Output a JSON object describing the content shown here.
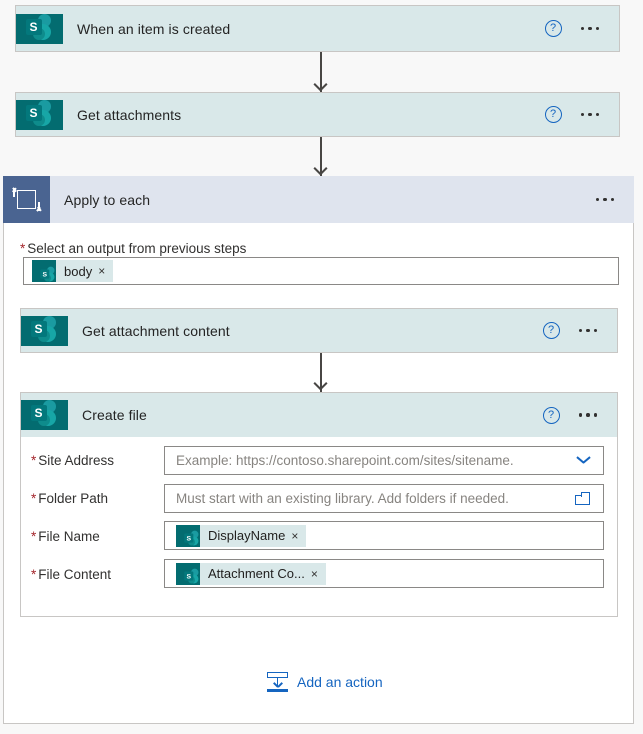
{
  "flow": {
    "steps": [
      {
        "id": "when-an-item-is-created",
        "title": "When an item is created",
        "icon": "sharepoint-icon",
        "help_glyph": "?",
        "menu_glyph": "…"
      },
      {
        "id": "get-attachments",
        "title": "Get attachments",
        "icon": "sharepoint-icon",
        "help_glyph": "?",
        "menu_glyph": "…"
      }
    ],
    "loop": {
      "title": "Apply to each",
      "icon": "loop-icon",
      "menu_glyph": "…",
      "output_field": {
        "required_marker": "*",
        "label": "Select an output from previous steps",
        "token": {
          "label": "body",
          "close_glyph": "×",
          "icon": "sharepoint-icon"
        }
      },
      "inner_steps": [
        {
          "id": "get-attachment-content",
          "title": "Get attachment content",
          "icon": "sharepoint-icon",
          "help_glyph": "?",
          "menu_glyph": "…"
        }
      ],
      "create_file": {
        "title": "Create file",
        "icon": "sharepoint-icon",
        "help_glyph": "?",
        "menu_glyph": "…",
        "fields": [
          {
            "id": "site-address",
            "required_marker": "*",
            "label": "Site Address",
            "placeholder": "Example: https://contoso.sharepoint.com/sites/sitename.",
            "control": "dropdown",
            "value": ""
          },
          {
            "id": "folder-path",
            "required_marker": "*",
            "label": "Folder Path",
            "placeholder": "Must start with an existing library. Add folders if needed.",
            "control": "folder-picker",
            "value": ""
          },
          {
            "id": "file-name",
            "required_marker": "*",
            "label": "File Name",
            "control": "token",
            "token": {
              "label": "DisplayName",
              "close_glyph": "×",
              "icon": "sharepoint-icon"
            }
          },
          {
            "id": "file-content",
            "required_marker": "*",
            "label": "File Content",
            "control": "token",
            "token": {
              "label": "Attachment Co...",
              "close_glyph": "×",
              "icon": "sharepoint-icon"
            }
          }
        ]
      }
    },
    "add_action": {
      "label": "Add an action",
      "icon": "add-action-icon"
    }
  },
  "colors": {
    "sharepoint_teal": "#036c70",
    "card_header": "#d9e8e9",
    "loop_header": "#dfe4ee",
    "loop_tile": "#4a6491",
    "accent_blue": "#1565c0",
    "required_red": "#a4262c",
    "border_gray": "#c8c6c4"
  }
}
